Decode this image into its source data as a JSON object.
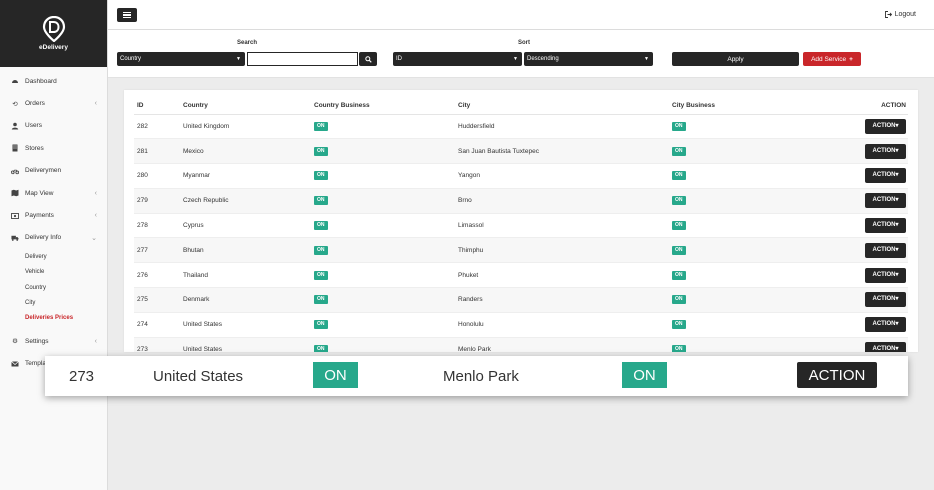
{
  "app": {
    "brand": "eDelivery",
    "logout_label": "Logout"
  },
  "colors": {
    "dark": "#262626",
    "accent_red": "#c9262a",
    "on_green": "#27a88b"
  },
  "sidebar": {
    "items": [
      {
        "label": "Dashboard",
        "icon": "dashboard-icon"
      },
      {
        "label": "Orders",
        "icon": "orders-icon",
        "chevron": "‹"
      },
      {
        "label": "Users",
        "icon": "user-icon"
      },
      {
        "label": "Stores",
        "icon": "store-icon"
      },
      {
        "label": "Deliverymen",
        "icon": "motorbike-icon"
      },
      {
        "label": "Map View",
        "icon": "map-icon",
        "chevron": "‹"
      },
      {
        "label": "Payments",
        "icon": "payments-icon",
        "chevron": "‹"
      },
      {
        "label": "Delivery Info",
        "icon": "truck-icon",
        "chevron": "⌄"
      }
    ],
    "subitems": [
      {
        "label": "Delivery"
      },
      {
        "label": "Vehicle"
      },
      {
        "label": "Country"
      },
      {
        "label": "City"
      },
      {
        "label": "Deliveries Prices"
      }
    ],
    "bottom_items": [
      {
        "label": "Settings",
        "icon": "gear-icon",
        "chevron": "‹"
      },
      {
        "label": "Templat",
        "icon": "mail-icon"
      }
    ]
  },
  "filters": {
    "search_label": "Search",
    "search_field_selected": "Country",
    "search_value": "",
    "sort_label": "Sort",
    "sort_field_selected": "ID",
    "sort_order_selected": "Descending",
    "apply_label": "Apply",
    "add_service_label": "Add Service"
  },
  "table": {
    "headers": [
      "ID",
      "Country",
      "Country Business",
      "City",
      "City Business",
      "ACTION"
    ],
    "rows": [
      {
        "id": "282",
        "country": "United Kingdom",
        "country_business": "ON",
        "city": "Huddersfield",
        "city_business": "ON",
        "action": "ACTION"
      },
      {
        "id": "281",
        "country": "Mexico",
        "country_business": "ON",
        "city": "San Juan Bautista Tuxtepec",
        "city_business": "ON",
        "action": "ACTION"
      },
      {
        "id": "280",
        "country": "Myanmar",
        "country_business": "ON",
        "city": "Yangon",
        "city_business": "ON",
        "action": "ACTION"
      },
      {
        "id": "279",
        "country": "Czech Republic",
        "country_business": "ON",
        "city": "Brno",
        "city_business": "ON",
        "action": "ACTION"
      },
      {
        "id": "278",
        "country": "Cyprus",
        "country_business": "ON",
        "city": "Limassol",
        "city_business": "ON",
        "action": "ACTION"
      },
      {
        "id": "277",
        "country": "Bhutan",
        "country_business": "ON",
        "city": "Thimphu",
        "city_business": "ON",
        "action": "ACTION"
      },
      {
        "id": "276",
        "country": "Thailand",
        "country_business": "ON",
        "city": "Phuket",
        "city_business": "ON",
        "action": "ACTION"
      },
      {
        "id": "275",
        "country": "Denmark",
        "country_business": "ON",
        "city": "Randers",
        "city_business": "ON",
        "action": "ACTION"
      },
      {
        "id": "274",
        "country": "United States",
        "country_business": "ON",
        "city": "Honolulu",
        "city_business": "ON",
        "action": "ACTION"
      },
      {
        "id": "273",
        "country": "United States",
        "country_business": "ON",
        "city": "Menlo Park",
        "city_business": "ON",
        "action": "ACTION"
      }
    ]
  },
  "zoom_row": {
    "id": "273",
    "country": "United States",
    "country_business": "ON",
    "city": "Menlo Park",
    "city_business": "ON",
    "action": "ACTION"
  }
}
